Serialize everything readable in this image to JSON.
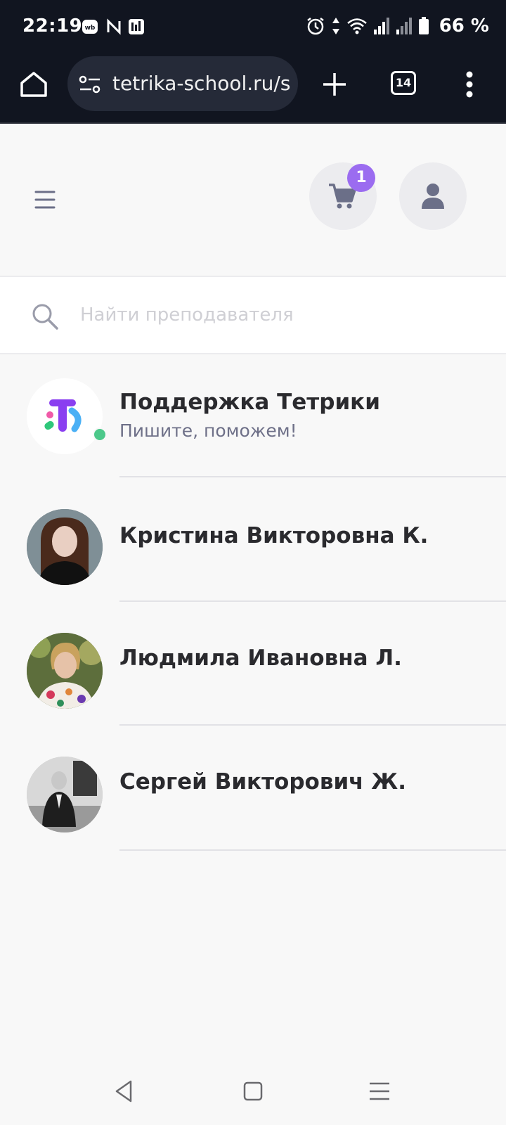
{
  "status_bar": {
    "time": "22:19",
    "app_icons": [
      "wildberries-icon",
      "n-icon",
      "news-icon"
    ],
    "right_icons": [
      "alarm-icon",
      "data-arrows-icon",
      "wifi-icon",
      "signal-icon",
      "signal-roaming-icon",
      "battery-icon"
    ],
    "battery": "66 %"
  },
  "browser": {
    "url": "tetrika-school.ru/s",
    "tab_count": "14"
  },
  "header": {
    "cart_badge": "1"
  },
  "search": {
    "placeholder": "Найти преподавателя",
    "value": ""
  },
  "contacts": [
    {
      "name": "Поддержка Тетрики",
      "subtitle": "Пишите, поможем!",
      "online": true,
      "avatar": "tetrika-logo"
    },
    {
      "name": "Кристина Викторовна К.",
      "avatar": "photo-woman-dark-hair"
    },
    {
      "name": "Людмила Ивановна Л.",
      "avatar": "photo-woman-floral"
    },
    {
      "name": "Сергей Викторович Ж.",
      "avatar": "photo-man-bw"
    }
  ],
  "colors": {
    "status_bar_bg": "#111520",
    "badge": "#9b6cf0",
    "online": "#4cc88a",
    "icon_gray": "#6b6f88"
  }
}
